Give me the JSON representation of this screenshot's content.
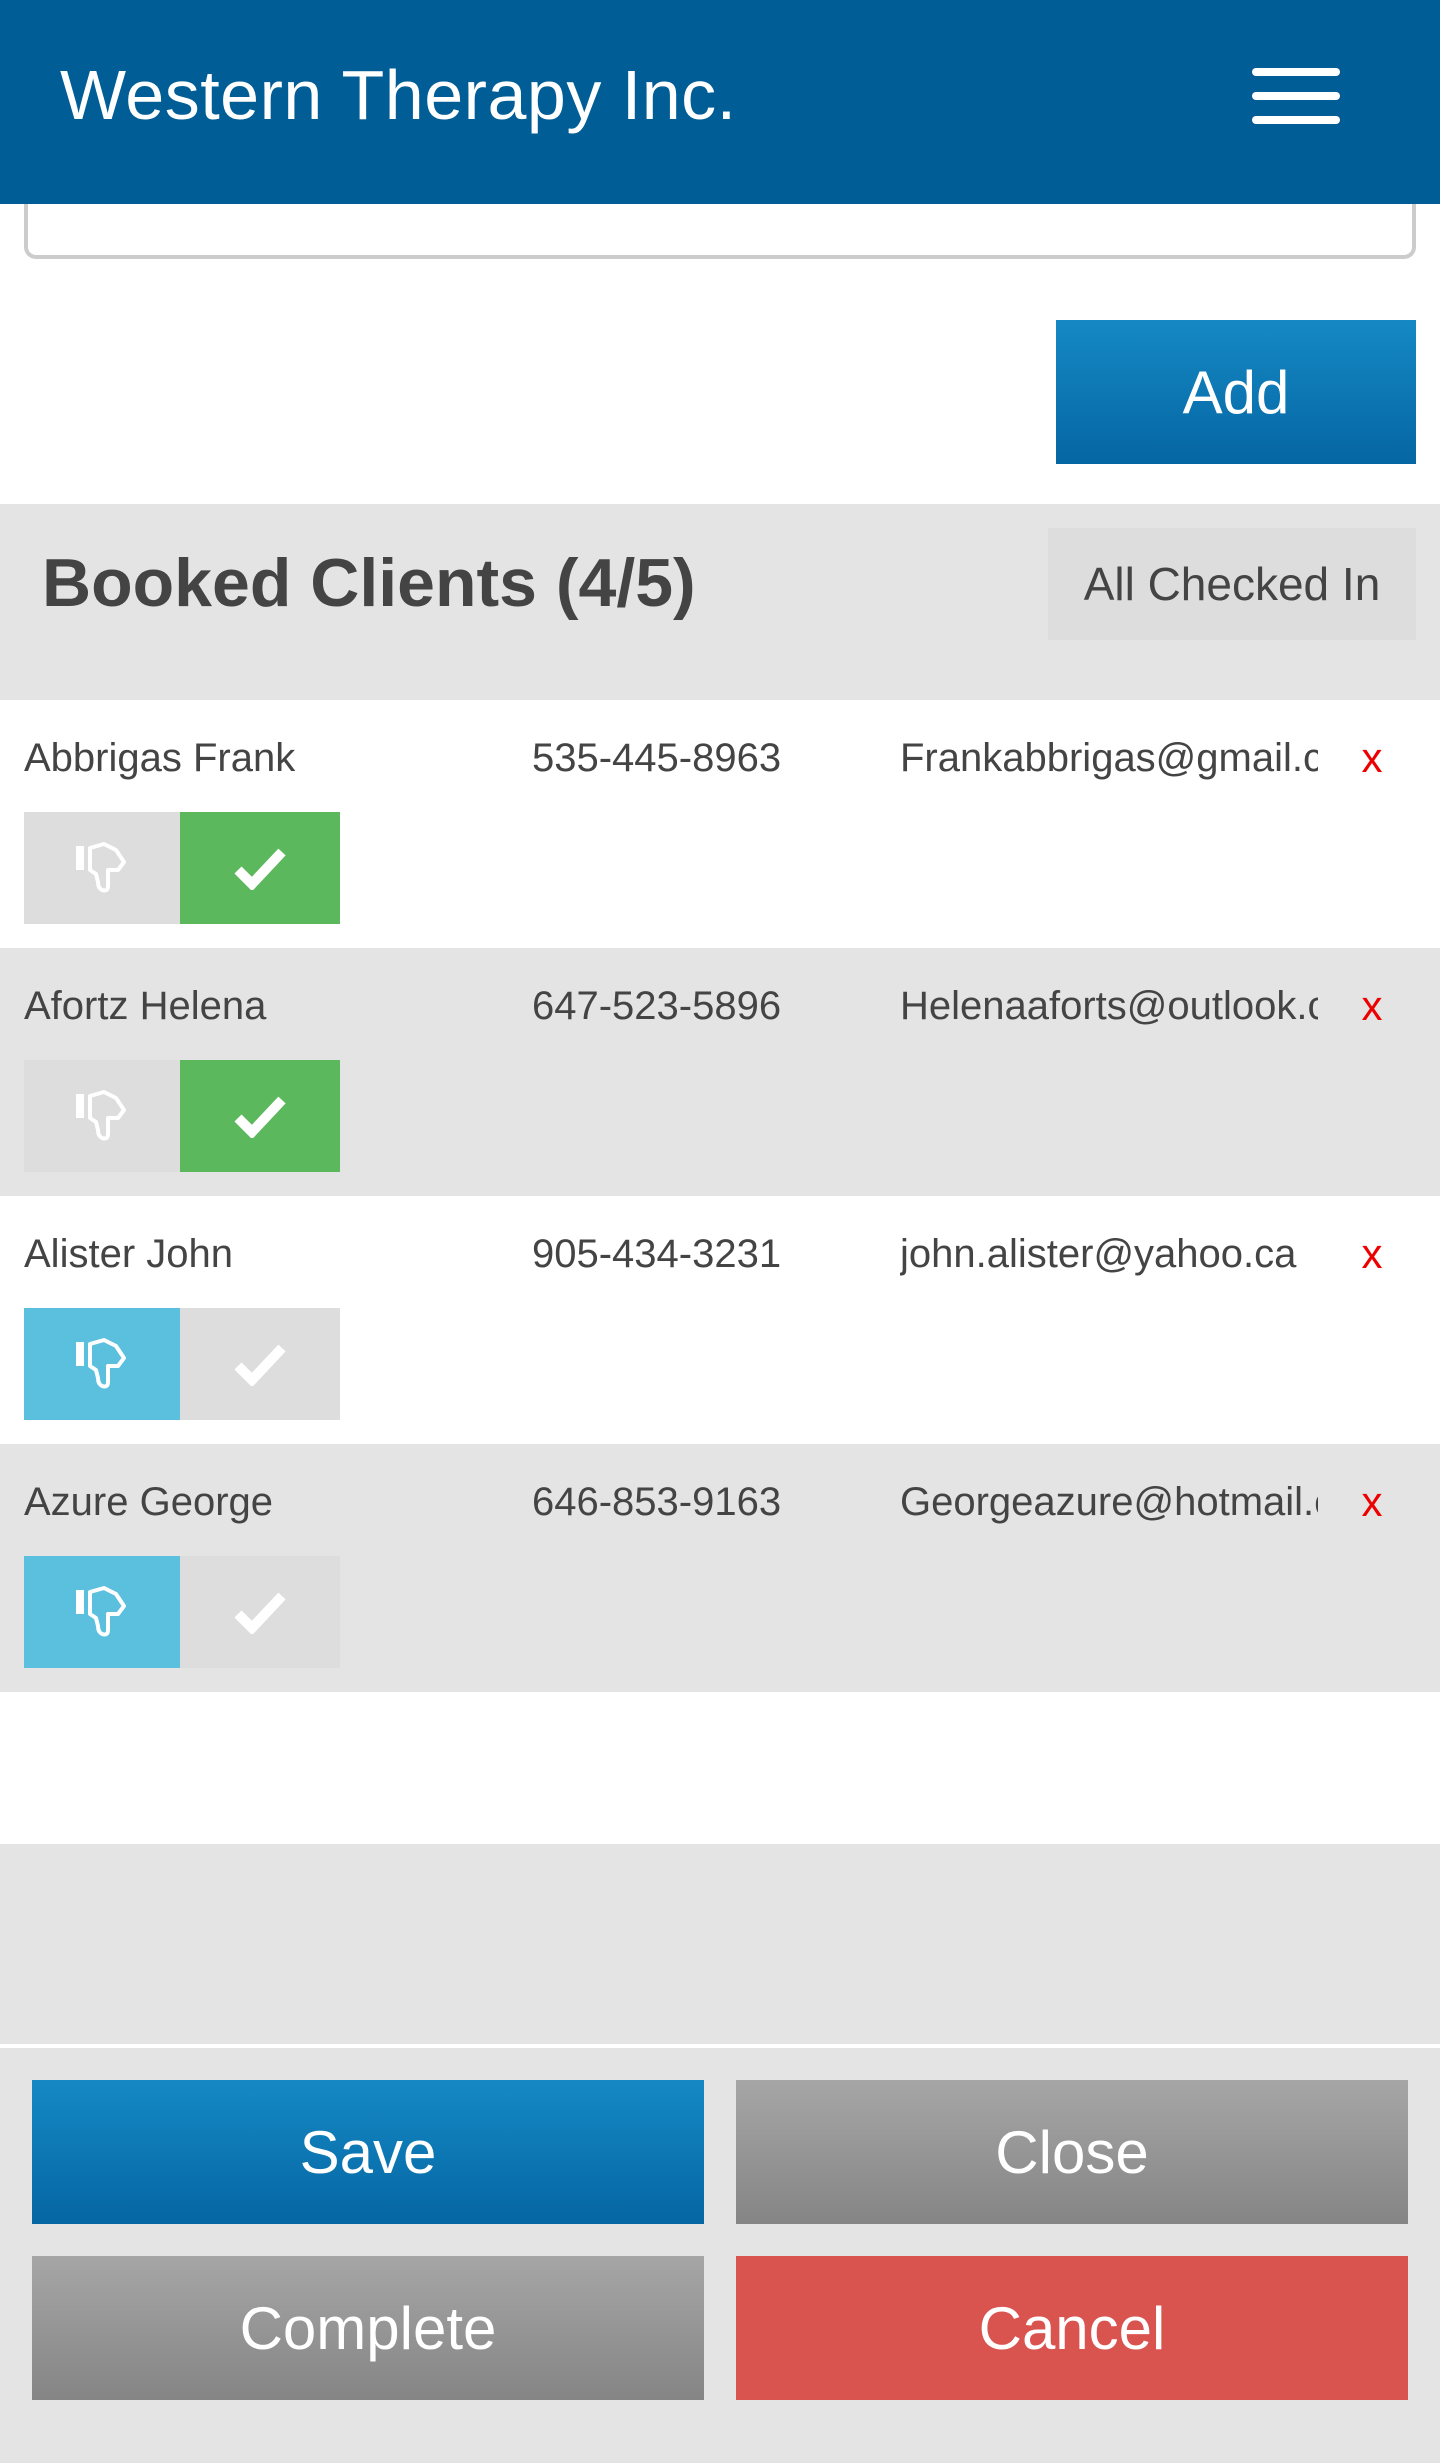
{
  "app": {
    "title": "Western Therapy Inc.",
    "menu_icon": "hamburger-menu-icon"
  },
  "notes": {
    "value": "",
    "placeholder": ""
  },
  "add_button": {
    "label": "Add"
  },
  "booked_clients": {
    "title": "Booked Clients (4/5)",
    "checked_in_count": 4,
    "capacity": 5,
    "all_checked_in_label": "All Checked In"
  },
  "clients": [
    {
      "name": "Abbrigas Frank",
      "phone": "535-445-8963",
      "email": "Frankabbrigas@gmail.com",
      "remove_label": "x",
      "status": "checked-in"
    },
    {
      "name": "Afortz Helena",
      "phone": "647-523-5896",
      "email": "Helenaaforts@outlook.com",
      "remove_label": "x",
      "status": "checked-in"
    },
    {
      "name": "Alister John",
      "phone": "905-434-3231",
      "email": "john.alister@yahoo.ca",
      "remove_label": "x",
      "status": "no-show"
    },
    {
      "name": "Azure George",
      "phone": "646-853-9163",
      "email": "Georgeazure@hotmail.com",
      "remove_label": "x",
      "status": "no-show"
    }
  ],
  "icons": {
    "no_show": "thumbs-down-icon",
    "check_in": "checkmark-icon",
    "remove": "remove-x-icon"
  },
  "colors": {
    "header": "#005d96",
    "primary_top": "#1589c4",
    "primary_bottom": "#0566a3",
    "no_show_active": "#5bc0de",
    "check_in_active": "#5cb85c",
    "inactive": "#dddddd",
    "danger": "#d9534f",
    "remove": "#ee0000"
  },
  "footer": {
    "save_label": "Save",
    "close_label": "Close",
    "complete_label": "Complete",
    "cancel_label": "Cancel"
  }
}
